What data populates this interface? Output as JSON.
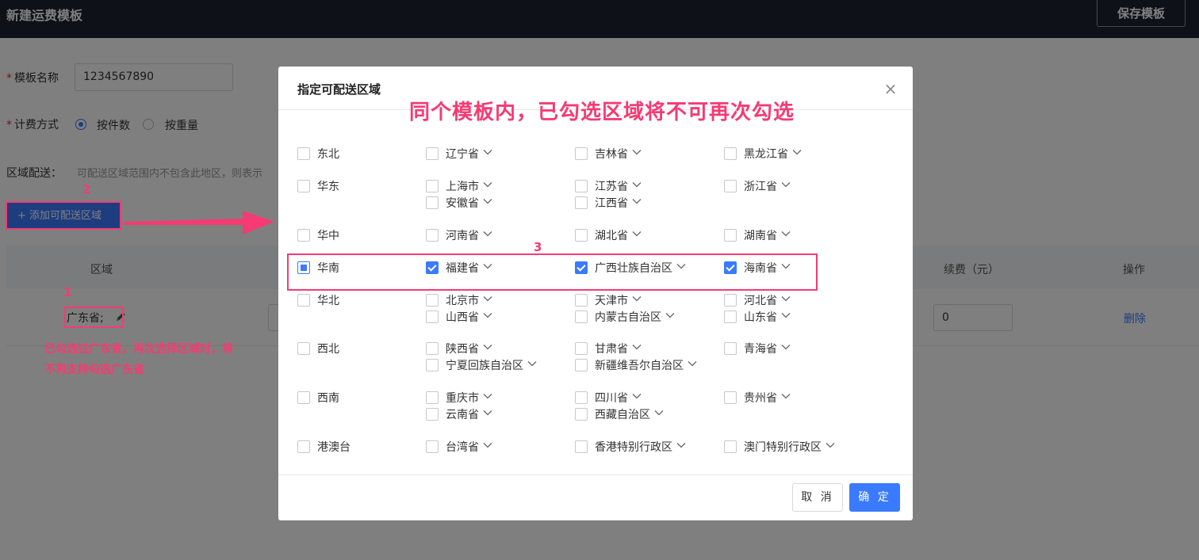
{
  "topbar": {
    "title": "新建运费模板",
    "save_label": "保存模板"
  },
  "form": {
    "name_label": "模板名称",
    "name_value": "1234567890",
    "billing_label": "计费方式",
    "billing_options": [
      "按件数",
      "按重量"
    ],
    "billing_selected": "按件数",
    "region_label": "区域配送：",
    "region_hint": "可配送区域范围内不包含此地区，则表示",
    "add_label": "+ 添加可配送区域"
  },
  "table": {
    "headers": {
      "region": "区域",
      "fee": "续费（元）",
      "action": "操作"
    },
    "row": {
      "region": "广东省;",
      "fee": "0",
      "delete": "删除"
    }
  },
  "annotations": {
    "n1": "1",
    "n2": "2",
    "n3": "3",
    "note_line1": "已勾选过广东省，再次选择区域时，将",
    "note_line2": "不再支持勾选广东省",
    "banner": "同个模板内，已勾选区域将不可再次勾选"
  },
  "modal": {
    "title": "指定可配送区域",
    "cancel_label": "取 消",
    "ok_label": "确 定",
    "groups": [
      {
        "name": "东北",
        "state": "none",
        "provinces": [
          {
            "name": "辽宁省",
            "checked": false
          },
          {
            "name": "吉林省",
            "checked": false
          },
          {
            "name": "黑龙江省",
            "checked": false
          }
        ]
      },
      {
        "name": "华东",
        "state": "none",
        "provinces": [
          {
            "name": "上海市",
            "checked": false
          },
          {
            "name": "江苏省",
            "checked": false
          },
          {
            "name": "浙江省",
            "checked": false
          },
          {
            "name": "安徽省",
            "checked": false
          },
          {
            "name": "江西省",
            "checked": false
          }
        ]
      },
      {
        "name": "华中",
        "state": "none",
        "provinces": [
          {
            "name": "河南省",
            "checked": false
          },
          {
            "name": "湖北省",
            "checked": false
          },
          {
            "name": "湖南省",
            "checked": false
          }
        ]
      },
      {
        "name": "华南",
        "state": "partial",
        "provinces": [
          {
            "name": "福建省",
            "checked": true
          },
          {
            "name": "广西壮族自治区",
            "checked": true
          },
          {
            "name": "海南省",
            "checked": true
          }
        ]
      },
      {
        "name": "华北",
        "state": "none",
        "provinces": [
          {
            "name": "北京市",
            "checked": false
          },
          {
            "name": "天津市",
            "checked": false
          },
          {
            "name": "河北省",
            "checked": false
          },
          {
            "name": "山西省",
            "checked": false
          },
          {
            "name": "内蒙古自治区",
            "checked": false
          },
          {
            "name": "山东省",
            "checked": false
          }
        ]
      },
      {
        "name": "西北",
        "state": "none",
        "provinces": [
          {
            "name": "陕西省",
            "checked": false
          },
          {
            "name": "甘肃省",
            "checked": false
          },
          {
            "name": "青海省",
            "checked": false
          },
          {
            "name": "宁夏回族自治区",
            "checked": false
          },
          {
            "name": "新疆维吾尔自治区",
            "checked": false
          }
        ]
      },
      {
        "name": "西南",
        "state": "none",
        "provinces": [
          {
            "name": "重庆市",
            "checked": false
          },
          {
            "name": "四川省",
            "checked": false
          },
          {
            "name": "贵州省",
            "checked": false
          },
          {
            "name": "云南省",
            "checked": false
          },
          {
            "name": "西藏自治区",
            "checked": false
          }
        ]
      },
      {
        "name": "港澳台",
        "state": "none",
        "provinces": [
          {
            "name": "台湾省",
            "checked": false
          },
          {
            "name": "香港特别行政区",
            "checked": false
          },
          {
            "name": "澳门特别行政区",
            "checked": false
          }
        ]
      }
    ]
  },
  "colors": {
    "accent": "#3a7afe",
    "annotation": "#f53b73",
    "topbar": "#1f2333"
  }
}
